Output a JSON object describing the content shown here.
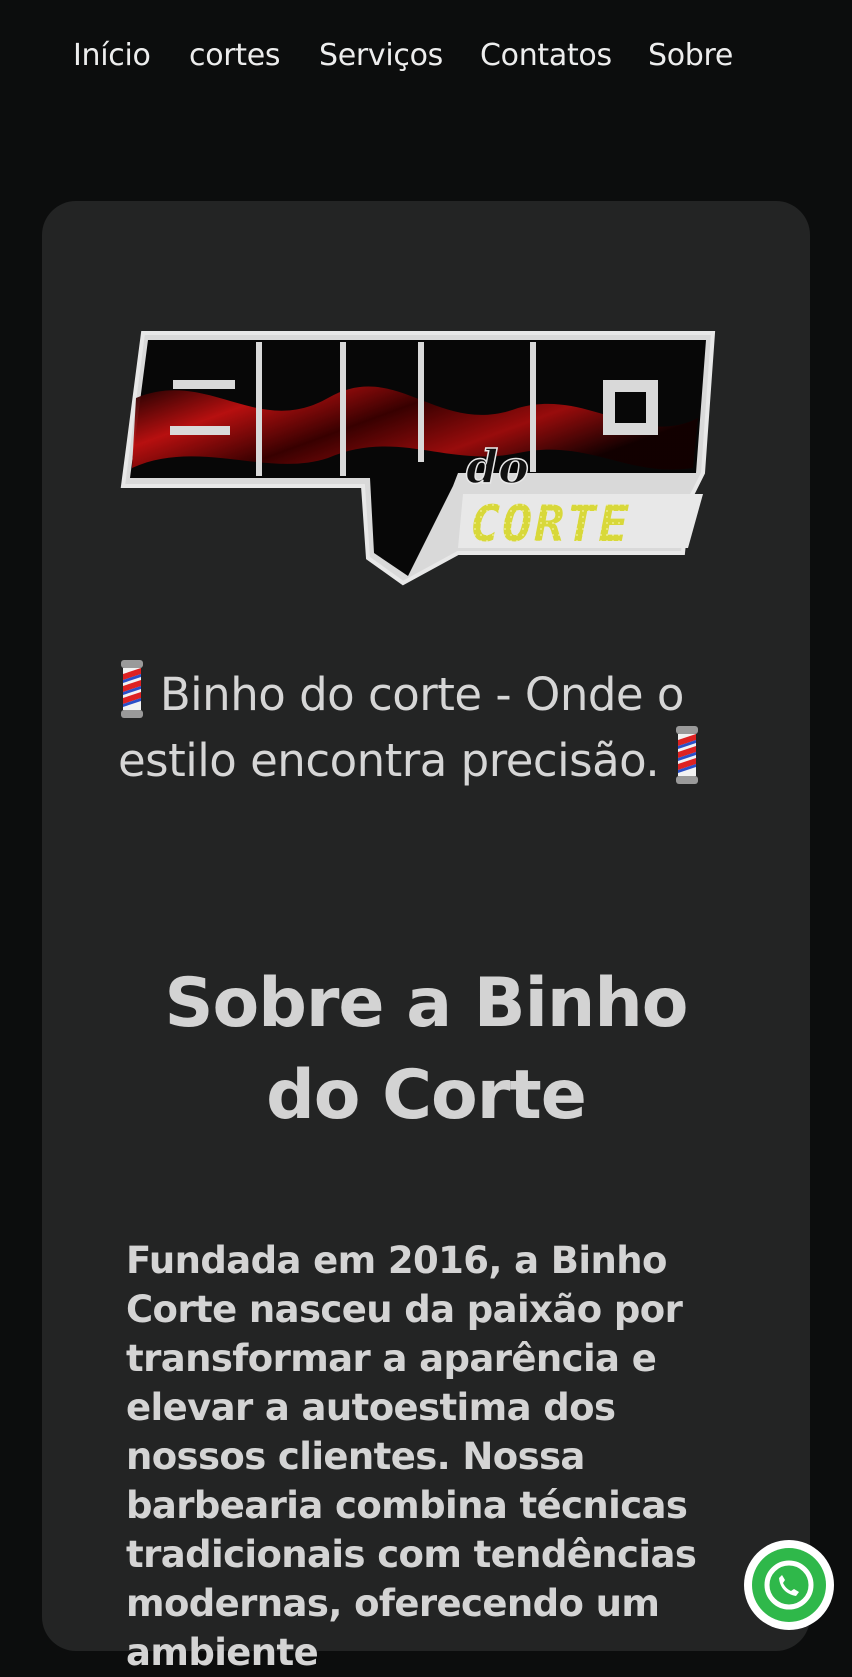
{
  "nav": {
    "items": [
      "Início",
      "cortes",
      "Serviços",
      "Contatos",
      "Sobre"
    ]
  },
  "logo": {
    "main_text": "BINHO",
    "small_text": "do",
    "sub_text": "CORTE"
  },
  "tagline": {
    "text": "Binho do corte - Onde o estilo encontra precisão."
  },
  "about": {
    "title": "Sobre a Binho do Corte",
    "body": "Fundada em 2016, a Binho Corte nasceu da paixão por transformar a aparência e elevar a autoestima dos nossos clientes. Nossa barbearia combina técnicas tradicionais com tendências modernas, oferecendo um ambiente"
  },
  "whatsapp": {
    "icon": "whatsapp-icon"
  },
  "colors": {
    "background": "#0c0d0d",
    "card": "#232424",
    "text": "#d6d6d6",
    "logo_accent": "#d8d83a",
    "logo_red": "#b80d0d",
    "whatsapp_green": "#2fb84a"
  }
}
